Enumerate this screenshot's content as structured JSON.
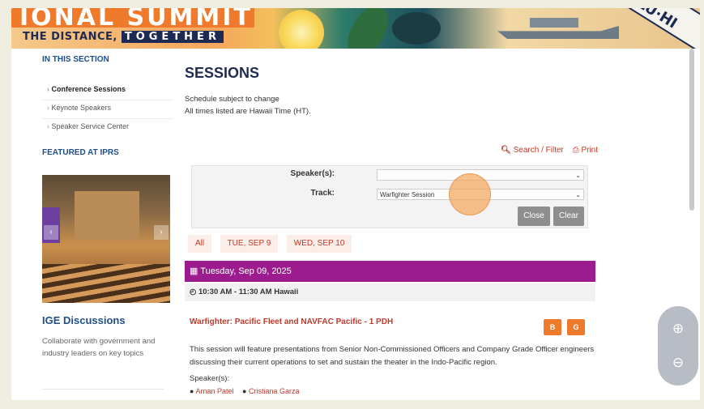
{
  "banner": {
    "title": "IONAL SUMMIT",
    "subtitle_prefix": "THE DISTANCE,",
    "subtitle_box": "TOGETHER",
    "badge": "LU·HI"
  },
  "sidebar": {
    "section_heading": "IN THIS SECTION",
    "items": [
      {
        "label": "Conference Sessions"
      },
      {
        "label": "Keynote Speakers"
      },
      {
        "label": "Speaker Service Center"
      }
    ],
    "featured_heading": "FEATURED AT IPRS",
    "carousel_prev": "‹",
    "carousel_next": "›",
    "feature_title": "IGE Discussions",
    "feature_desc": "Collaborate with government and industry leaders on key topics"
  },
  "main": {
    "title": "SESSIONS",
    "note_line1": "Schedule subject to change",
    "note_line2": "All times listed are Hawaii Time (HT).",
    "search_filter_label": "Search / Filter",
    "print_label": "Print",
    "filter": {
      "speakers_label": "Speaker(s):",
      "speakers_value": "",
      "track_label": "Track:",
      "track_value": "Warfighter Session",
      "close_label": "Close",
      "clear_label": "Clear"
    },
    "days": [
      "All",
      "TUE, SEP 9",
      "WED, SEP 10"
    ],
    "date_heading": "Tuesday, Sep 09, 2025",
    "time_heading": "10:30 AM - 11:30 AM Hawaii",
    "session": {
      "title": "Warfighter: Pacific Fleet and NAVFAC Pacific - 1 PDH",
      "btn1": "B",
      "btn2": "G",
      "description": "This session will feature presentations from Senior Non-Commissioned Officers and Company Grade Officer engineers discussing their current operations to set and sustain the theater in the Indo-Pacific region.",
      "speakers_label": "Speaker(s):",
      "speakers": [
        "Arnan Patel",
        "Cristiana Garza"
      ]
    }
  },
  "zoom": {
    "zoom_in": "⊕",
    "zoom_out": "⊖"
  },
  "colors": {
    "accent_red": "#c0392b",
    "date_bar": "#9c1c8f",
    "orange": "#ef7a2c",
    "navy": "#1e4f8a"
  }
}
